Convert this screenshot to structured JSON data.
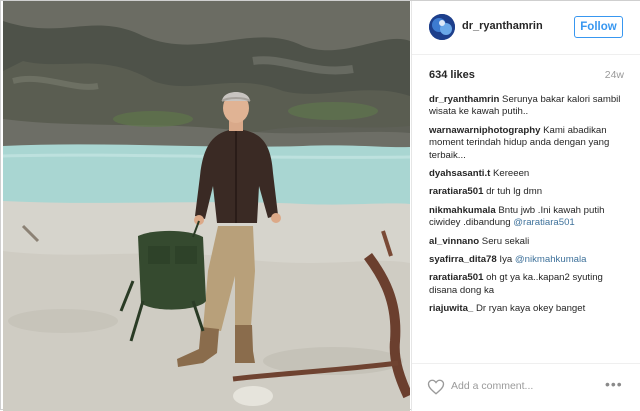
{
  "post": {
    "username": "dr_ryanthamrin",
    "follow_label": "Follow",
    "likes": "634 likes",
    "age": "24w",
    "comments": [
      {
        "user": "dr_ryanthamrin",
        "text": "Serunya bakar kalori sambil wisata ke kawah putih..",
        "mention": ""
      },
      {
        "user": "warnawarniphotography",
        "text": "Kami abadikan moment terindah hidup anda dengan yang terbaik...",
        "mention": ""
      },
      {
        "user": "dyahsasanti.t",
        "text": "Kereeen",
        "mention": ""
      },
      {
        "user": "raratiara501",
        "text": "dr tuh lg dmn",
        "mention": ""
      },
      {
        "user": "nikmahkumala",
        "text": "Bntu jwb .Ini kawah putih ciwidey .dibandung",
        "mention": "@raratiara501"
      },
      {
        "user": "al_vinnano",
        "text": "Seru sekali",
        "mention": ""
      },
      {
        "user": "syafirra_dita78",
        "text": "Iya",
        "mention": "@nikmahkumala"
      },
      {
        "user": "raratiara501",
        "text": "oh gt ya ka..kapan2 syuting disana dong ka",
        "mention": ""
      },
      {
        "user": "riajuwita_",
        "text": "Dr ryan kaya okey banget",
        "mention": ""
      }
    ],
    "add_comment_placeholder": "Add a comment...",
    "more_label": "•••"
  },
  "colors": {
    "accent": "#3897f0",
    "mention": "#3f729b",
    "lake": "#a9d6d2"
  },
  "icons": {
    "like": "heart-icon",
    "options": "more-options-icon"
  }
}
